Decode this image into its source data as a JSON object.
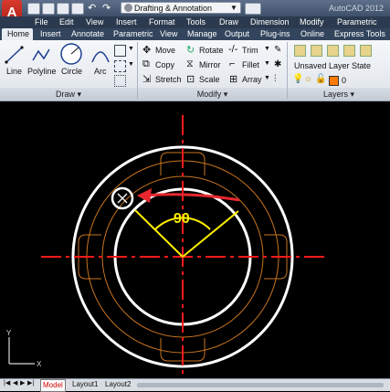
{
  "titlebar": {
    "app_logo": "A",
    "workspace": "Drafting & Annotation",
    "window_title": "AutoCAD 2012"
  },
  "menubar": [
    "File",
    "Edit",
    "View",
    "Insert",
    "Format",
    "Tools",
    "Draw",
    "Dimension",
    "Modify",
    "Parametric"
  ],
  "tabs": [
    "Home",
    "Insert",
    "Annotate",
    "Parametric",
    "View",
    "Manage",
    "Output",
    "Plug-ins",
    "Online",
    "Express Tools"
  ],
  "draw_panel": {
    "title": "Draw",
    "tools": [
      "Line",
      "Polyline",
      "Circle",
      "Arc"
    ]
  },
  "modify_panel": {
    "title": "Modify",
    "tools": [
      "Move",
      "Rotate",
      "Trim",
      "Copy",
      "Mirror",
      "Fillet",
      "Stretch",
      "Scale",
      "Array"
    ]
  },
  "layers_panel": {
    "title": "Layers",
    "layer_state": "Unsaved Layer State",
    "current_layer": "0"
  },
  "drawing": {
    "dimension_text": "90",
    "colors": {
      "circle": "#ffffff",
      "centerline": "#ff1a1a",
      "slot": "#c8741e",
      "dimension": "#ffee00",
      "annotation_arrow": "#e8262f"
    }
  },
  "layout_tabs": [
    "Model",
    "Layout1",
    "Layout2"
  ]
}
